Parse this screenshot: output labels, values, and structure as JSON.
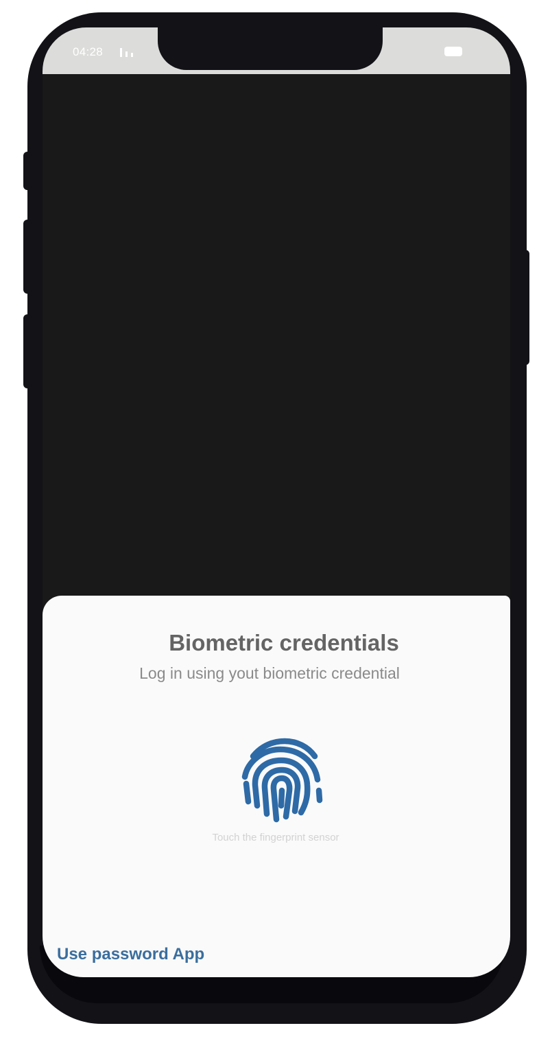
{
  "status_bar": {
    "time": "04:28",
    "signal_icon": "signal-bars-icon",
    "battery_icon": "battery-icon"
  },
  "sheet": {
    "title": "Biometric credentials",
    "subtitle": "Log in using yout biometric credential",
    "fingerprint_icon": "fingerprint-icon",
    "hint": "Touch the fingerprint sensor",
    "use_password_label": "Use password App"
  },
  "colors": {
    "accent": "#2e6aa6",
    "link": "#3a6e9e",
    "screen_background": "#181918",
    "sheet_background": "#fafafa",
    "status_bar": "#dcdcda",
    "device_frame": "#131217"
  }
}
